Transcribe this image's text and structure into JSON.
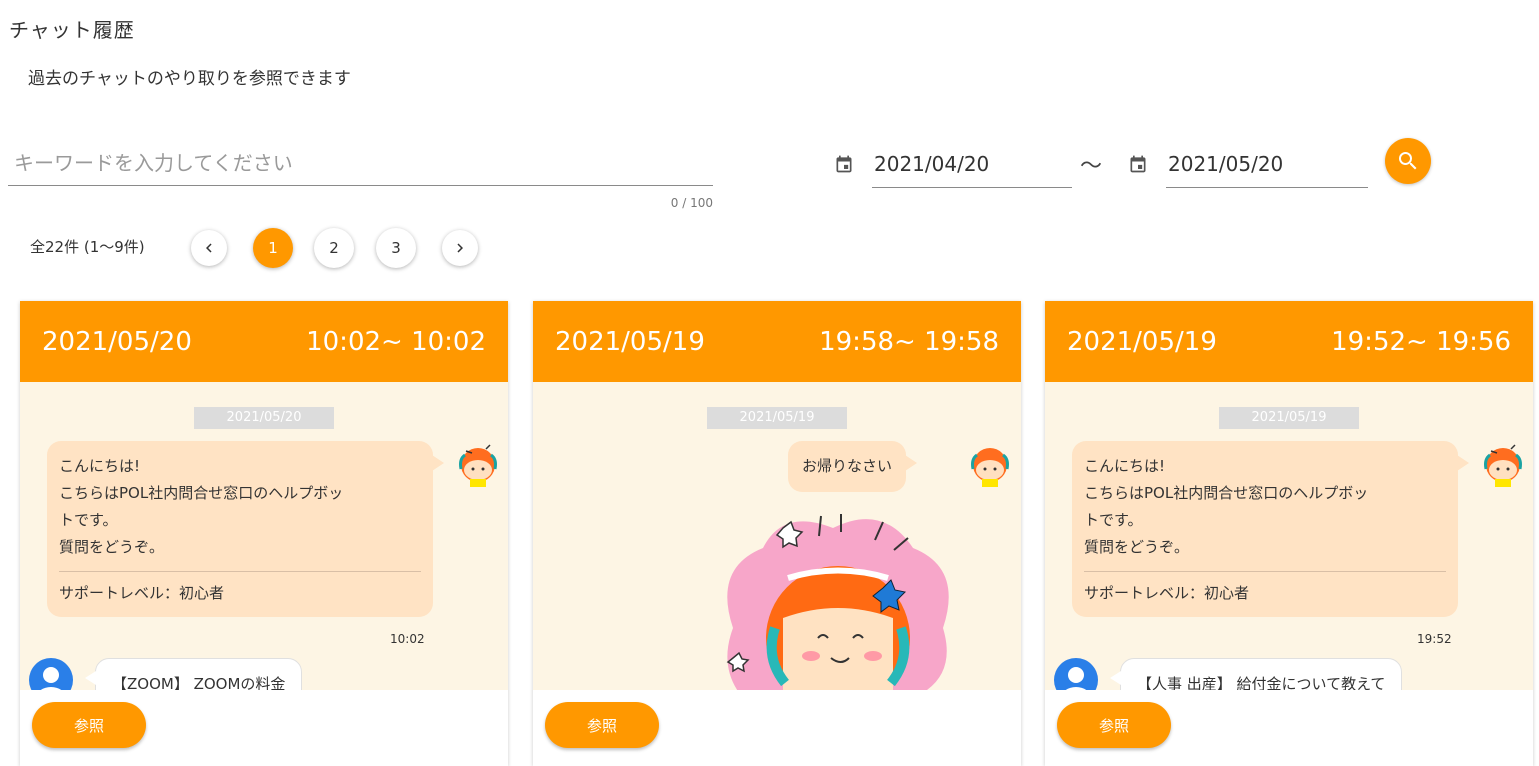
{
  "page": {
    "title": "チャット履歴",
    "description": "過去のチャットのやり取りを参照できます"
  },
  "search": {
    "keyword_placeholder": "キーワードを入力してください",
    "keyword_value": "",
    "counter": "0 / 100",
    "date_from": "2021/04/20",
    "date_to": "2021/05/20",
    "range_separator": "～",
    "search_icon": "search-icon",
    "calendar_icon": "calendar-icon"
  },
  "pagination": {
    "summary": "全22件 (1～9件)",
    "pages": [
      "1",
      "2",
      "3"
    ],
    "current": "1",
    "prev_icon": "chevron-left-icon",
    "next_icon": "chevron-right-icon"
  },
  "cards": [
    {
      "date": "2021/05/20",
      "time_range": "10:02~ 10:02",
      "chip": "2021/05/20",
      "bot_lines": [
        "こんにちは!",
        "こちらはPOL社内問合せ窓口のヘルプボッ",
        "トです。",
        "質問をどうぞ。"
      ],
      "support_level": "サポートレベル：初心者",
      "time": "10:02",
      "user_message": "【ZOOM】 ZOOMの料金",
      "button": "参照"
    },
    {
      "date": "2021/05/19",
      "time_range": "19:58~ 19:58",
      "chip": "2021/05/19",
      "bot_message": "お帰りなさい",
      "button": "参照"
    },
    {
      "date": "2021/05/19",
      "time_range": "19:52~ 19:56",
      "chip": "2021/05/19",
      "bot_lines": [
        "こんにちは!",
        "こちらはPOL社内問合せ窓口のヘルプボッ",
        "トです。",
        "質問をどうぞ。"
      ],
      "support_level": "サポートレベル：初心者",
      "time": "19:52",
      "user_message": "【人事 出産】 給付金について教えて",
      "button": "参照"
    }
  ],
  "colors": {
    "accent": "#ff9800",
    "card_body_bg": "#fdf5e4",
    "bot_bubble": "#ffe3c4",
    "user_avatar": "#2a7fe8"
  }
}
